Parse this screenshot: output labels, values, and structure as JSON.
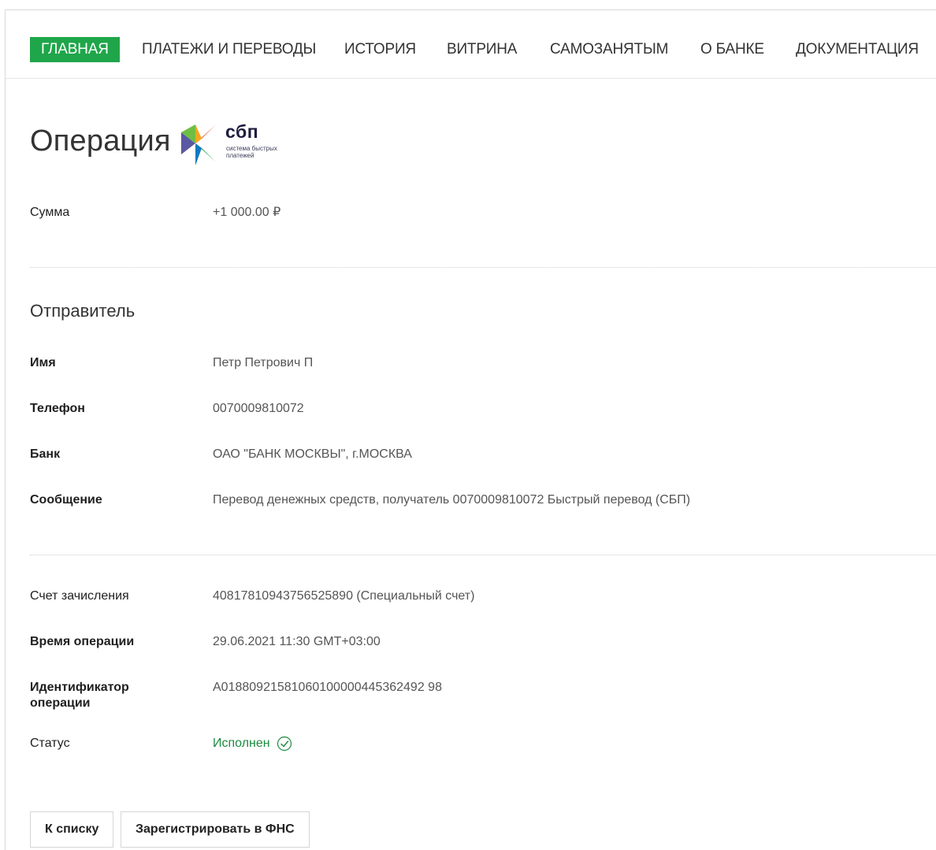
{
  "nav": {
    "items": [
      {
        "label": "ГЛАВНАЯ",
        "active": true
      },
      {
        "label": "ПЛАТЕЖИ И ПЕРЕВОДЫ",
        "active": false
      },
      {
        "label": "ИСТОРИЯ",
        "active": false
      },
      {
        "label": "ВИТРИНА",
        "active": false
      },
      {
        "label": "САМОЗАНЯТЫМ",
        "active": false
      },
      {
        "label": "О БАНКЕ",
        "active": false
      },
      {
        "label": "ДОКУМЕНТАЦИЯ",
        "active": false
      }
    ]
  },
  "page": {
    "title": "Операция",
    "logo": {
      "word": "сбп",
      "sub": "система быстрых платежей"
    }
  },
  "amount": {
    "label": "Сумма",
    "value": "+1 000.00 ₽"
  },
  "sender": {
    "title": "Отправитель",
    "name": {
      "label": "Имя",
      "value": "Петр Петрович П"
    },
    "phone": {
      "label": "Телефон",
      "value": "0070009810072"
    },
    "bank": {
      "label": "Банк",
      "value": "ОАО \"БАНК МОСКВЫ\", г.МОСКВА"
    },
    "message": {
      "label": "Сообщение",
      "value": "Перевод денежных средств, получатель 0070009810072 Быстрый перевод (СБП)"
    }
  },
  "details": {
    "account": {
      "label": "Счет зачисления",
      "value": "40817810943756525890 (Специальный счет)"
    },
    "time": {
      "label": "Время операции",
      "value": "29.06.2021 11:30 GMT+03:00"
    },
    "operation_id": {
      "label_line1": "Идентификатор",
      "label_line2": "операции",
      "value": "A01880921581060100000445362492 98"
    },
    "status": {
      "label": "Статус",
      "value": "Исполнен",
      "icon": "check-circle-icon",
      "color": "#1b8a3f"
    }
  },
  "actions": {
    "back_label": "К списку",
    "register_label": "Зарегистрировать в ФНС"
  },
  "colors": {
    "accent": "#1fa64a"
  }
}
